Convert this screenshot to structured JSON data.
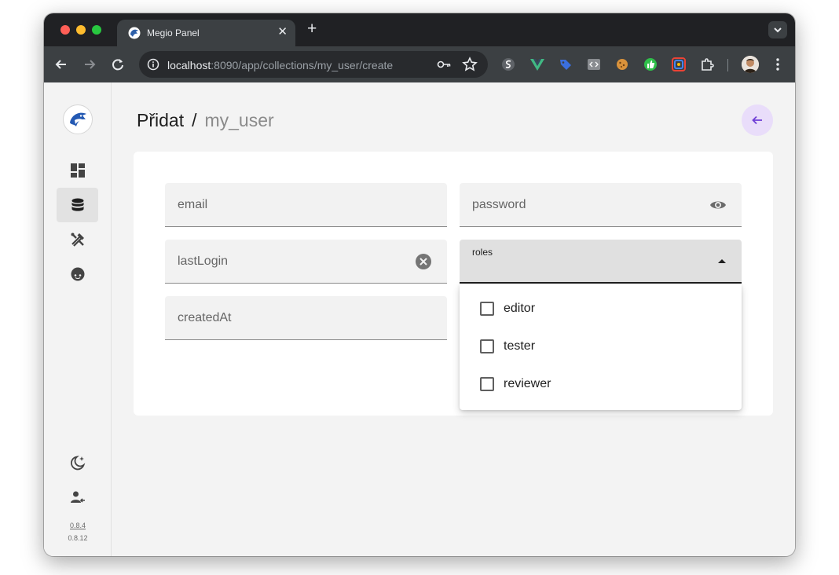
{
  "browser": {
    "tab_title": "Megio Panel",
    "tab_close": "✕",
    "new_tab": "+",
    "url_host": "localhost",
    "url_path": ":8090/app/collections/my_user/create"
  },
  "sidebar": {
    "items": [
      {
        "name": "dashboard",
        "icon": "dashboard-icon",
        "active": false
      },
      {
        "name": "collections",
        "icon": "database-icon",
        "active": true
      },
      {
        "name": "tools",
        "icon": "tools-icon",
        "active": false
      },
      {
        "name": "user",
        "icon": "face-icon",
        "active": false
      }
    ],
    "bottom_icons": [
      "theme-toggle-icon",
      "logout-icon"
    ],
    "version_link": "0.8.4",
    "version_text": "0.8.12"
  },
  "page": {
    "title": "Přidat",
    "separator": "/",
    "collection": "my_user"
  },
  "form": {
    "email_label": "email",
    "password_label": "password",
    "lastlogin_label": "lastLogin",
    "roles_label": "roles",
    "createdat_label": "createdAt"
  },
  "roles_menu": {
    "options": [
      "editor",
      "tester",
      "reviewer"
    ]
  },
  "colors": {
    "accent": "#6f3fd6",
    "accent_bg": "#e9ddfa",
    "browser_dark": "#202124"
  }
}
